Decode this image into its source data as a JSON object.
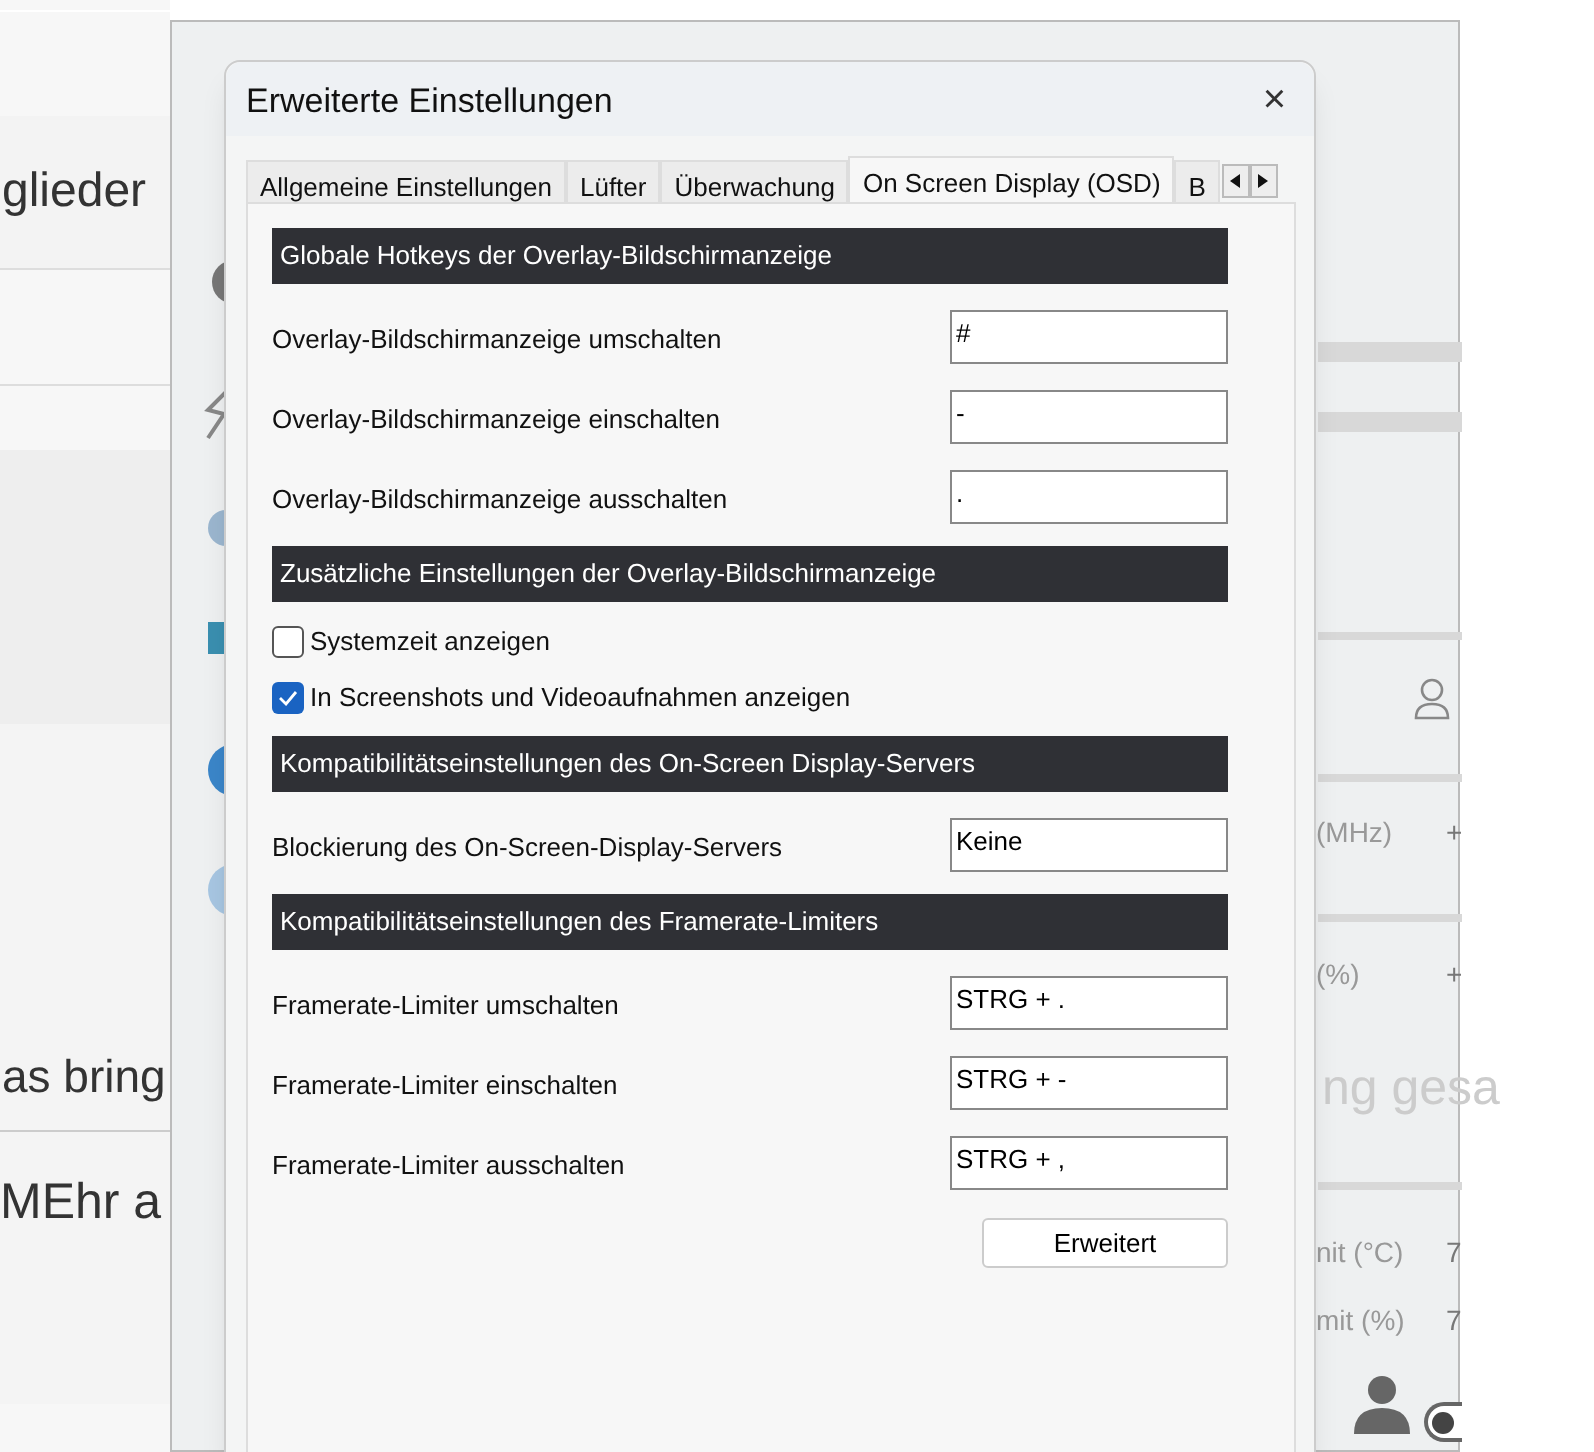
{
  "background_page": {
    "menu_label": "glieder",
    "line_1": "as bring",
    "line_2": "MEhr a",
    "faded_line": "ng gesa"
  },
  "afterburner": {
    "rows": [
      {
        "label": "(MHz)",
        "value": "+"
      },
      {
        "label": "(%)",
        "value": "+"
      },
      {
        "label": "nit (°C)",
        "value": "7"
      },
      {
        "label": "mit (%)",
        "value": "7"
      }
    ],
    "toggle": {
      "on": false
    }
  },
  "dialog": {
    "title": "Erweiterte Einstellungen",
    "close": "×",
    "tabs": [
      {
        "label": "Allgemeine Einstellungen",
        "selected": false
      },
      {
        "label": "Lüfter",
        "selected": false
      },
      {
        "label": "Überwachung",
        "selected": false
      },
      {
        "label": "On Screen Display (OSD)",
        "selected": true
      },
      {
        "label": "B",
        "selected": false
      }
    ],
    "sections": [
      {
        "kind": "header",
        "text": "Globale Hotkeys der Overlay-Bildschirmanzeige"
      },
      {
        "kind": "field",
        "label": "Overlay-Bildschirmanzeige umschalten",
        "value": "#"
      },
      {
        "kind": "field",
        "label": "Overlay-Bildschirmanzeige einschalten",
        "value": "-"
      },
      {
        "kind": "field",
        "label": "Overlay-Bildschirmanzeige ausschalten",
        "value": "."
      },
      {
        "kind": "header",
        "text": "Zusätzliche Einstellungen der Overlay-Bildschirmanzeige"
      },
      {
        "kind": "checkbox",
        "label": "Systemzeit anzeigen",
        "checked": false
      },
      {
        "kind": "checkbox",
        "label": "In Screenshots und Videoaufnahmen anzeigen",
        "checked": true
      },
      {
        "kind": "header",
        "text": "Kompatibilitätseinstellungen des On-Screen Display-Servers"
      },
      {
        "kind": "field",
        "label": "Blockierung des On-Screen-Display-Servers",
        "value": "Keine"
      },
      {
        "kind": "header",
        "text": "Kompatibilitätseinstellungen des Framerate-Limiters"
      },
      {
        "kind": "field",
        "label": "Framerate-Limiter umschalten",
        "value": "STRG + ."
      },
      {
        "kind": "field",
        "label": "Framerate-Limiter einschalten",
        "value": "STRG + -"
      },
      {
        "kind": "field",
        "label": "Framerate-Limiter ausschalten",
        "value": "STRG + ,"
      }
    ],
    "button": "Erweitert"
  }
}
